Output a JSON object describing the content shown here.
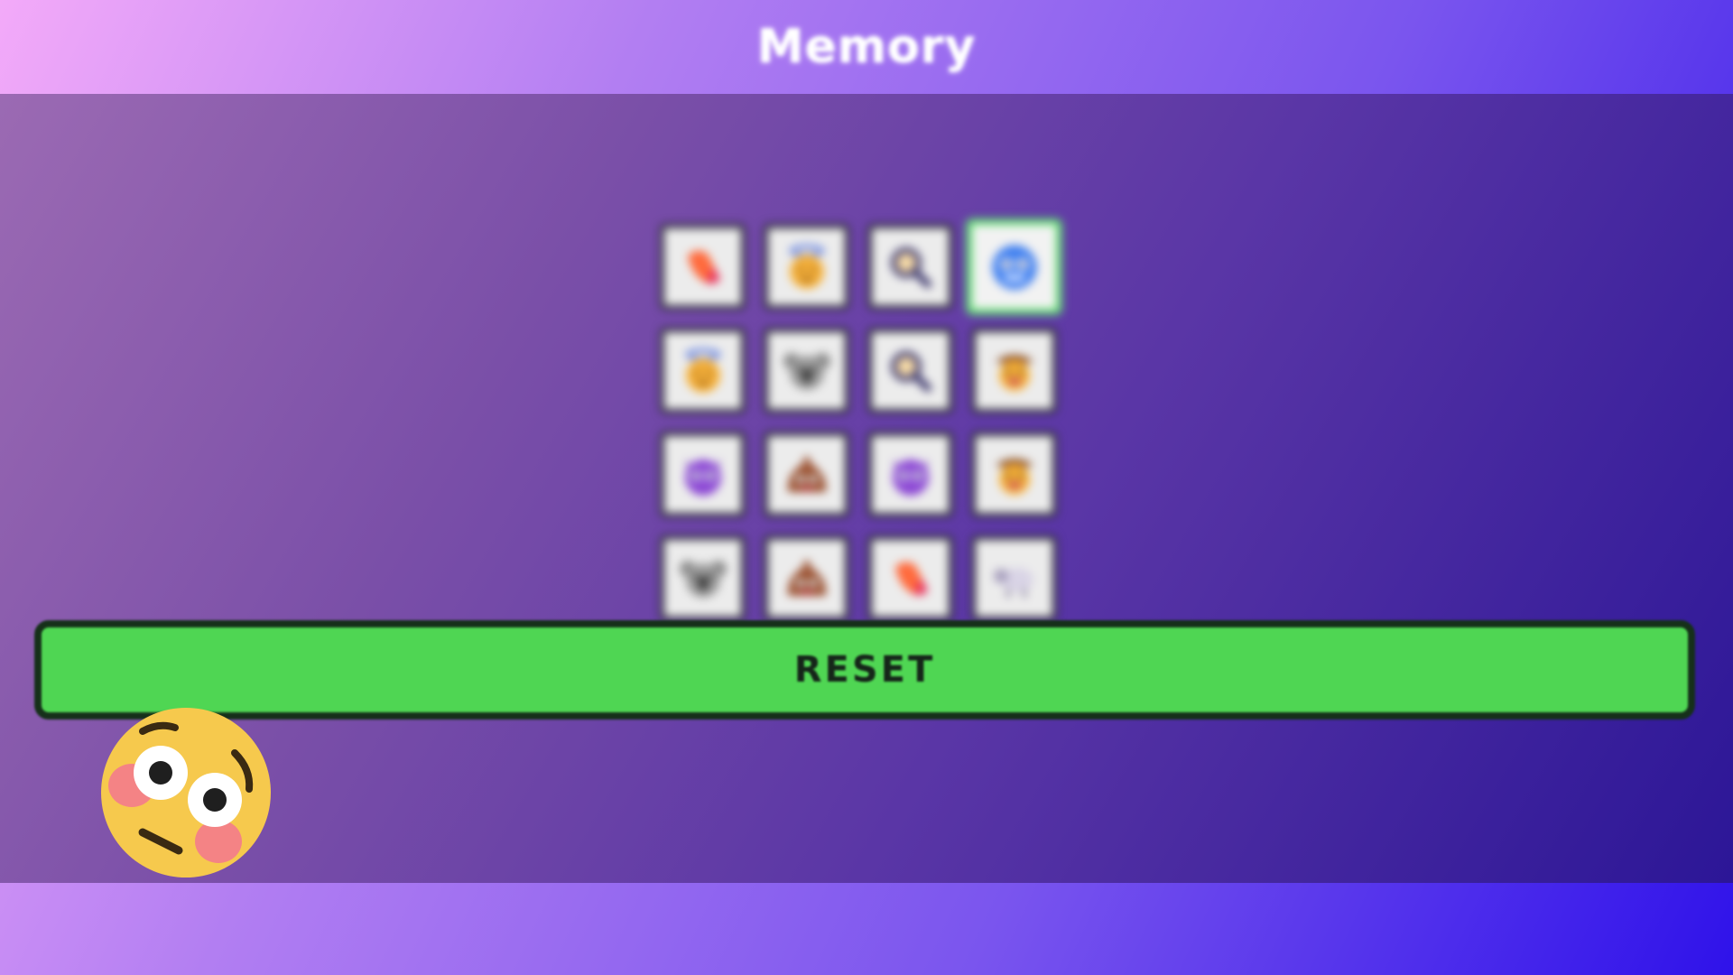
{
  "header": {
    "title": "Memory"
  },
  "board": {
    "columns": 4,
    "rows": 4,
    "cards": [
      {
        "icon": "sweet-potato-icon",
        "selected": false
      },
      {
        "icon": "angel-face-icon",
        "selected": false
      },
      {
        "icon": "magnifying-glass-icon",
        "selected": false
      },
      {
        "icon": "blue-robot-face-icon",
        "selected": true
      },
      {
        "icon": "angel-face-icon",
        "selected": false
      },
      {
        "icon": "koala-icon",
        "selected": false
      },
      {
        "icon": "magnifying-glass-icon",
        "selected": false
      },
      {
        "icon": "cowboy-face-icon",
        "selected": false
      },
      {
        "icon": "purple-devil-icon",
        "selected": false
      },
      {
        "icon": "poop-icon",
        "selected": false
      },
      {
        "icon": "purple-devil-icon",
        "selected": false
      },
      {
        "icon": "cowboy-face-icon",
        "selected": false
      },
      {
        "icon": "koala-icon",
        "selected": false
      },
      {
        "icon": "poop-icon",
        "selected": false
      },
      {
        "icon": "sweet-potato-icon",
        "selected": false
      },
      {
        "icon": "sheep-icon",
        "selected": false
      }
    ]
  },
  "controls": {
    "reset_label": "RESET"
  },
  "mascot": {
    "icon": "flushed-face-icon"
  },
  "colors": {
    "accent_green": "#4fd653",
    "selected_border": "#5be06a",
    "card_bg": "#ececec",
    "card_border": "#2b2b35"
  }
}
